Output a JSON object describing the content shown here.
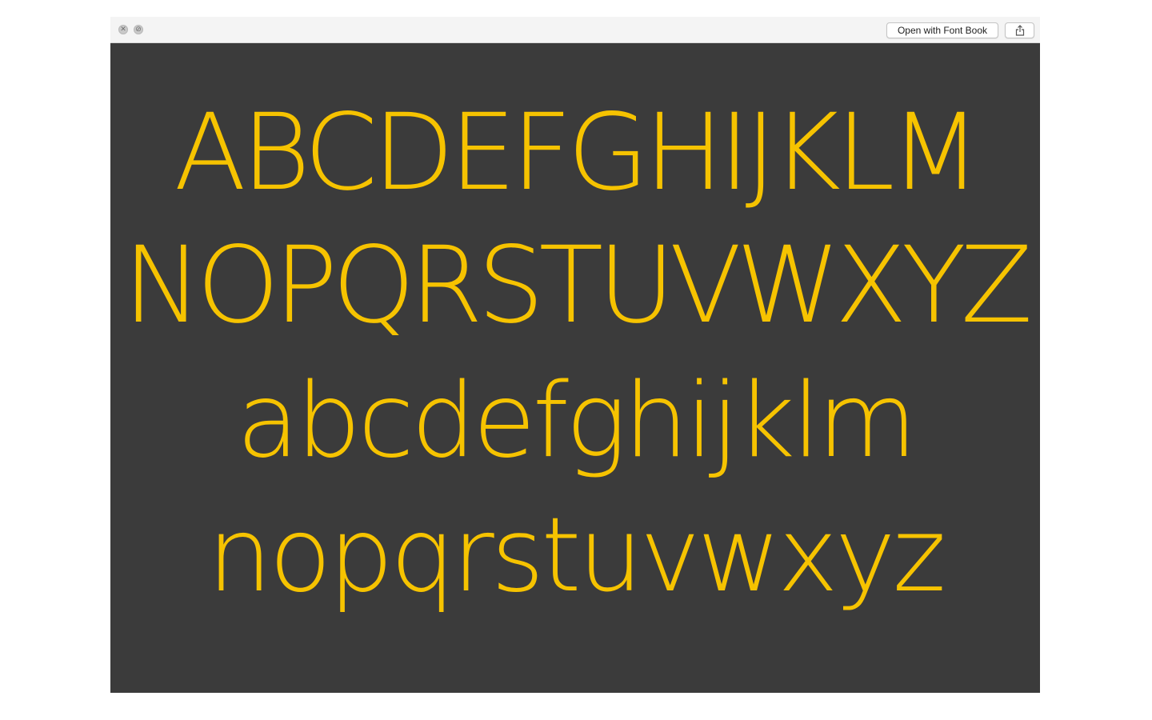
{
  "toolbar": {
    "open_button_label": "Open with Font Book",
    "share_icon": "share-icon",
    "close_icon": "close-icon",
    "fullscreen_icon": "fullscreen-icon"
  },
  "preview": {
    "lines": [
      "ABCDEFGHIJKLM",
      "NOPQRSTUVWXYZ",
      "abcdefghijklm",
      "nopqrstuvwxyz"
    ],
    "text_color": "#f6c300",
    "background_color": "#3b3b3b"
  }
}
